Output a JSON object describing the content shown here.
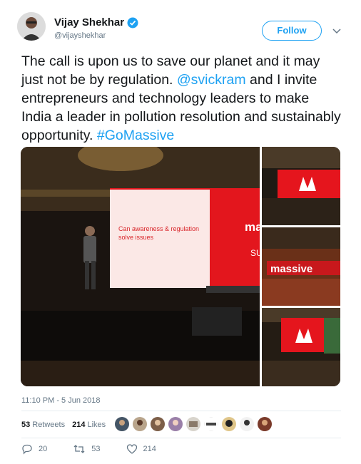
{
  "author": {
    "display_name": "Vijay Shekhar",
    "handle": "@vijayshekhar",
    "verified": true,
    "avatar_icon": "user-avatar"
  },
  "follow_label": "Follow",
  "tweet": {
    "segments": [
      {
        "text": "The call is upon us to save our planet and it may just not be by regulation. ",
        "type": "text"
      },
      {
        "text": "@svickram",
        "type": "mention"
      },
      {
        "text": " and I invite entrepreneurs and technology leaders to make India a leader in pollution resolution and sustainably opportunity. ",
        "type": "text"
      },
      {
        "text": "#GoMassive",
        "type": "hashtag"
      }
    ]
  },
  "media": {
    "main_slide_text": "Can awareness & regulation solve issues",
    "brand_text": "massive",
    "slide_fragment": "SU"
  },
  "timestamp": "11:10 PM - 5 Jun 2018",
  "stats": {
    "retweets_count": "53",
    "retweets_label": "Retweets",
    "likes_count": "214",
    "likes_label": "Likes",
    "liker_count": 9
  },
  "actions": {
    "replies": "20",
    "retweets": "53",
    "likes": "214"
  },
  "colors": {
    "accent": "#1da1f2",
    "text": "#14171a",
    "muted": "#657786",
    "stage_red": "#e5151d"
  }
}
